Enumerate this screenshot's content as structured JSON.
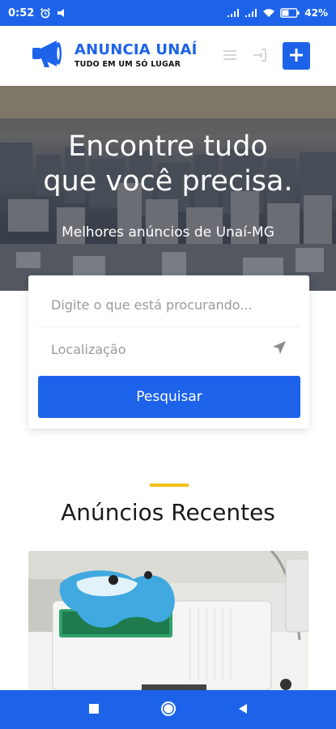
{
  "status_bar": {
    "time": "0:52",
    "battery": "42",
    "icons": [
      "alarm-icon",
      "cast-icon",
      "signal-icon",
      "signal-icon",
      "wifi-icon",
      "battery-icon"
    ]
  },
  "header": {
    "brand_title": "ANUNCIA UNAÍ",
    "brand_subtitle": "TUDO EM UM SÓ LUGAR",
    "icons": [
      "megaphone-icon",
      "menu-icon",
      "login-icon",
      "plus-icon"
    ]
  },
  "hero": {
    "title_line1": "Encontre tudo",
    "title_line2": "que você precisa.",
    "subtitle": "Melhores anúncios de Unaí-MG"
  },
  "search": {
    "query_placeholder": "Digite o que está procurando...",
    "query_value": "",
    "location_placeholder": "Localização",
    "location_value": "",
    "button_label": "Pesquisar"
  },
  "recent": {
    "title": "Anúncios Recentes"
  },
  "colors": {
    "brand": "#1d63ea",
    "accent": "#f4bf18"
  },
  "nav": {
    "icons": [
      "recents-square-icon",
      "home-circle-icon",
      "back-triangle-icon"
    ]
  }
}
